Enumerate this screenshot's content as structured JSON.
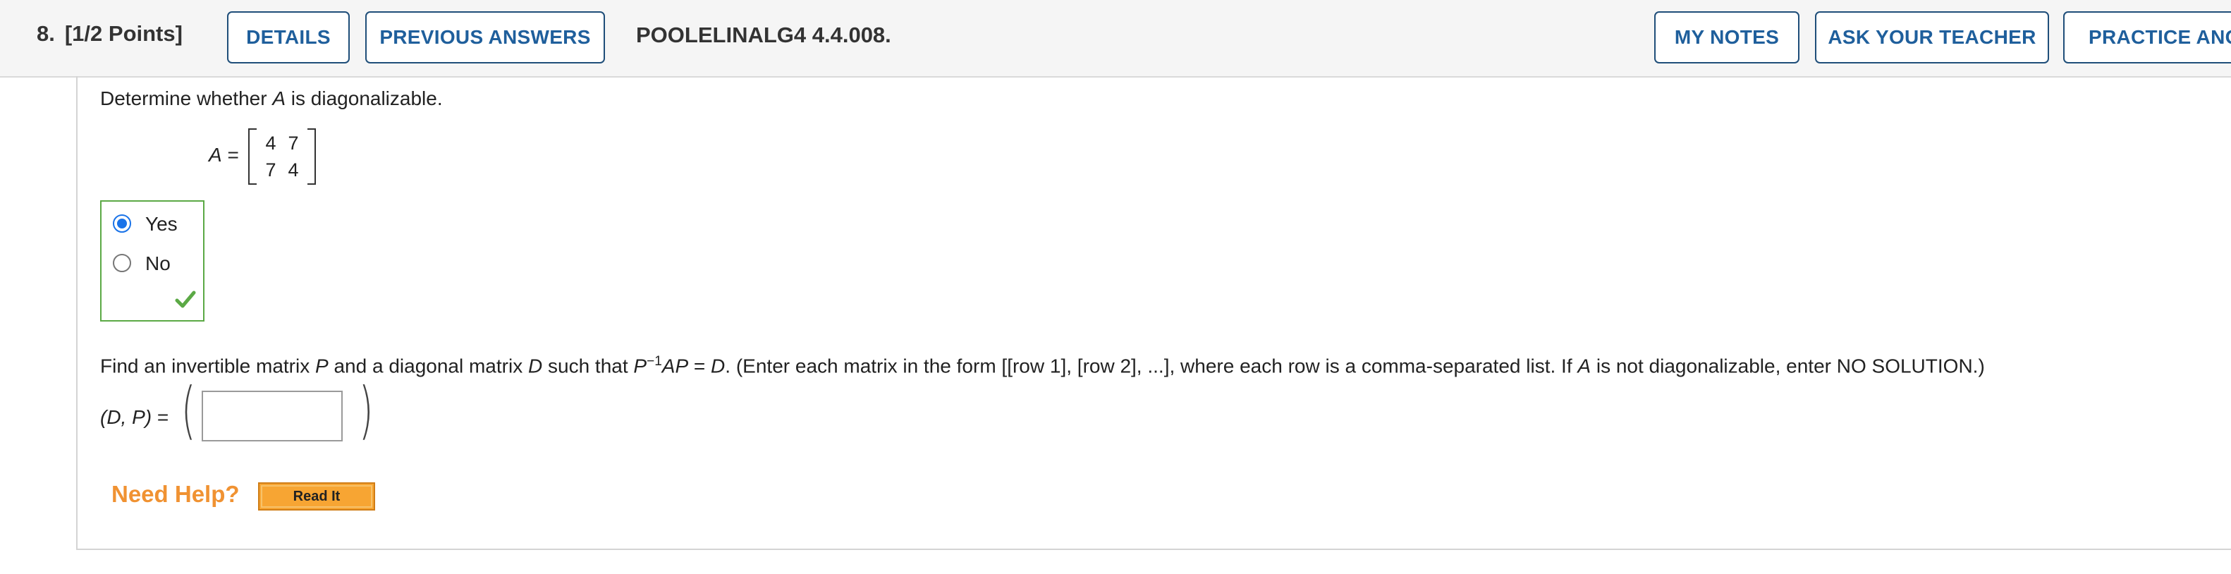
{
  "header": {
    "question_number": "8.",
    "points": "[1/2 Points]",
    "details_label": "DETAILS",
    "previous_answers_label": "PREVIOUS ANSWERS",
    "question_id": "POOLELINALG4 4.4.008.",
    "my_notes_label": "MY NOTES",
    "ask_teacher_label": "ASK YOUR TEACHER",
    "practice_label": "PRACTICE ANO"
  },
  "part1": {
    "prompt_before": "Determine whether ",
    "prompt_var": "A",
    "prompt_after": " is diagonalizable.",
    "matrix_name": "A",
    "equals": "=",
    "matrix": [
      [
        "4",
        "7"
      ],
      [
        "7",
        "4"
      ]
    ],
    "options": [
      {
        "label": "Yes",
        "selected": true
      },
      {
        "label": "No",
        "selected": false
      }
    ],
    "status": "correct-check-icon"
  },
  "part2": {
    "t1": "Find an invertible matrix ",
    "v1": "P",
    "t2": " and a diagonal matrix ",
    "v2": "D",
    "t3": " such that ",
    "v3": "P",
    "exp": "−1",
    "v4": "AP",
    "t4": " = ",
    "v5": "D",
    "t5": ". (Enter each matrix in the form [[row 1], [row 2], ...], where each row is a comma-separated list. If ",
    "v6": "A",
    "t6": " is not diagonalizable, enter NO SOLUTION.)",
    "pair_label": "(D, P)",
    "pair_equals": " =",
    "paren_open": "(",
    "paren_close": ")",
    "answer_value": ""
  },
  "help": {
    "need_help_label": "Need Help?",
    "read_it_label": "Read It"
  },
  "colors": {
    "button_border": "#1f4e79",
    "button_text": "#1f5f9c",
    "correct_green": "#5ba945",
    "radio_blue": "#1a73e8",
    "help_orange": "#f09232",
    "read_it_bg": "#f7a533"
  }
}
